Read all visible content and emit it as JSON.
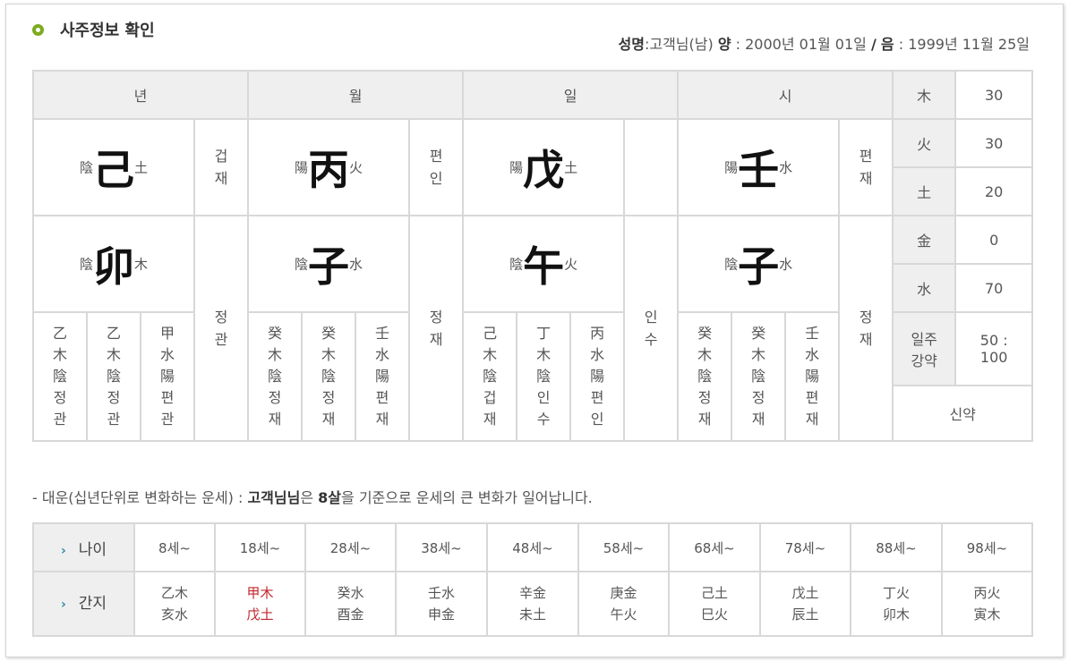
{
  "header": {
    "title": "사주정보 확인",
    "name_label": "성명",
    "name": ":고객님(남)",
    "solar_label": "양",
    "solar_date": ": 2000년 01월 01일",
    "sep": "/",
    "lunar_label": "음",
    "lunar_date": ": 1999년 11월 25일"
  },
  "pillars_header": [
    "년",
    "월",
    "일",
    "시"
  ],
  "stems": [
    {
      "yy": "陰",
      "char": "己",
      "el": "土",
      "god": "겁재"
    },
    {
      "yy": "陽",
      "char": "丙",
      "el": "火",
      "god": "편인"
    },
    {
      "yy": "陽",
      "char": "戊",
      "el": "土",
      "god": ""
    },
    {
      "yy": "陽",
      "char": "壬",
      "el": "水",
      "god": "편재"
    }
  ],
  "branches": [
    {
      "yy": "陰",
      "char": "卯",
      "el": "木",
      "god": "정관"
    },
    {
      "yy": "陰",
      "char": "子",
      "el": "水",
      "god": "정재"
    },
    {
      "yy": "陰",
      "char": "午",
      "el": "火",
      "god": "인수"
    },
    {
      "yy": "陰",
      "char": "子",
      "el": "水",
      "god": "정재"
    }
  ],
  "jijanggan": [
    [
      "乙木陰정관",
      "乙木陰정관",
      "甲水陽편관"
    ],
    [
      "癸木陰정재",
      "癸木陰정재",
      "壬水陽편재"
    ],
    [
      "己木陰겁재",
      "丁木陰인수",
      "丙水陽편인"
    ],
    [
      "癸木陰정재",
      "癸木陰정재",
      "壬水陽편재"
    ]
  ],
  "ohaeng": [
    {
      "label": "木",
      "value": "30"
    },
    {
      "label": "火",
      "value": "30"
    },
    {
      "label": "土",
      "value": "20"
    },
    {
      "label": "金",
      "value": "0"
    },
    {
      "label": "水",
      "value": "70"
    }
  ],
  "strength": {
    "label": "일주 강약",
    "value": "50 : 100",
    "result": "신약"
  },
  "daeun_intro": {
    "prefix": "- 대운(십년단위로 변화하는 운세) : ",
    "name": "고객님님",
    "mid1": "은 ",
    "age": "8살",
    "mid2": "을 기준으로 운세의 큰 변화가 일어납니다."
  },
  "daeun": {
    "age_label": "나이",
    "ganji_label": "간지",
    "ages": [
      "8세~",
      "18세~",
      "28세~",
      "38세~",
      "48세~",
      "58세~",
      "68세~",
      "78세~",
      "88세~",
      "98세~"
    ],
    "ganji": [
      {
        "top": "乙木",
        "bottom": "亥水"
      },
      {
        "top": "甲木",
        "bottom": "戊土"
      },
      {
        "top": "癸水",
        "bottom": "酉金"
      },
      {
        "top": "壬水",
        "bottom": "申金"
      },
      {
        "top": "辛金",
        "bottom": "未土"
      },
      {
        "top": "庚金",
        "bottom": "午火"
      },
      {
        "top": "己土",
        "bottom": "巳火"
      },
      {
        "top": "戊土",
        "bottom": "辰土"
      },
      {
        "top": "丁火",
        "bottom": "卯木"
      },
      {
        "top": "丙火",
        "bottom": "寅木"
      }
    ],
    "highlight_color": "#c1272d"
  }
}
